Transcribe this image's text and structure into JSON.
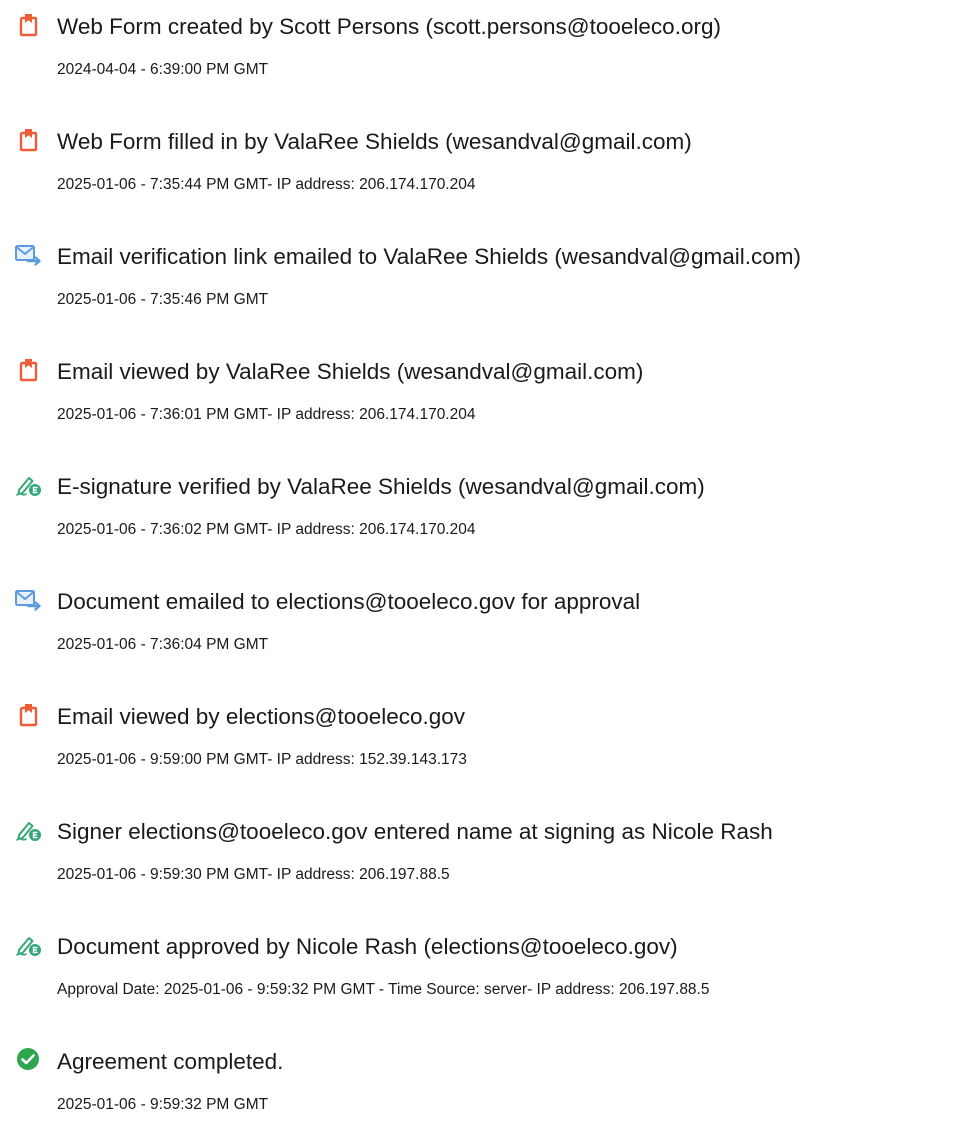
{
  "colors": {
    "document_icon": "#EE5C38",
    "email_icon_blue": "#5D9BE0",
    "esign_icon_green": "#35A776",
    "complete_icon_green": "#2EA64E",
    "text": "#1a1a1a"
  },
  "events": [
    {
      "icon": "document-icon",
      "title": "Web Form created by Scott Persons (scott.persons@tooeleco.org)",
      "meta": "2024-04-04 - 6:39:00 PM GMT"
    },
    {
      "icon": "document-icon",
      "title": "Web Form filled in by ValaRee Shields (wesandval@gmail.com)",
      "meta": "2025-01-06 - 7:35:44 PM GMT- IP address: 206.174.170.204"
    },
    {
      "icon": "email-icon",
      "title": "Email verification link emailed to ValaRee Shields (wesandval@gmail.com)",
      "meta": "2025-01-06 - 7:35:46 PM GMT"
    },
    {
      "icon": "document-icon",
      "title": "Email viewed by ValaRee Shields (wesandval@gmail.com)",
      "meta": "2025-01-06 - 7:36:01 PM GMT- IP address: 206.174.170.204"
    },
    {
      "icon": "esign-icon",
      "title": "E-signature verified by ValaRee Shields (wesandval@gmail.com)",
      "meta": "2025-01-06 - 7:36:02 PM GMT- IP address: 206.174.170.204"
    },
    {
      "icon": "email-icon",
      "title": "Document emailed to elections@tooeleco.gov for approval",
      "meta": "2025-01-06 - 7:36:04 PM GMT"
    },
    {
      "icon": "document-icon",
      "title": "Email viewed by elections@tooeleco.gov",
      "meta": "2025-01-06 - 9:59:00 PM GMT- IP address: 152.39.143.173"
    },
    {
      "icon": "esign-icon",
      "title": "Signer elections@tooeleco.gov entered name at signing as Nicole Rash",
      "meta": "2025-01-06 - 9:59:30 PM GMT- IP address: 206.197.88.5"
    },
    {
      "icon": "esign-icon",
      "title": "Document approved by Nicole Rash (elections@tooeleco.gov)",
      "meta": "Approval Date: 2025-01-06 - 9:59:32 PM GMT - Time Source: server- IP address: 206.197.88.5"
    },
    {
      "icon": "checkmark-circle-icon",
      "title": "Agreement completed.",
      "meta": "2025-01-06 - 9:59:32 PM GMT"
    }
  ]
}
